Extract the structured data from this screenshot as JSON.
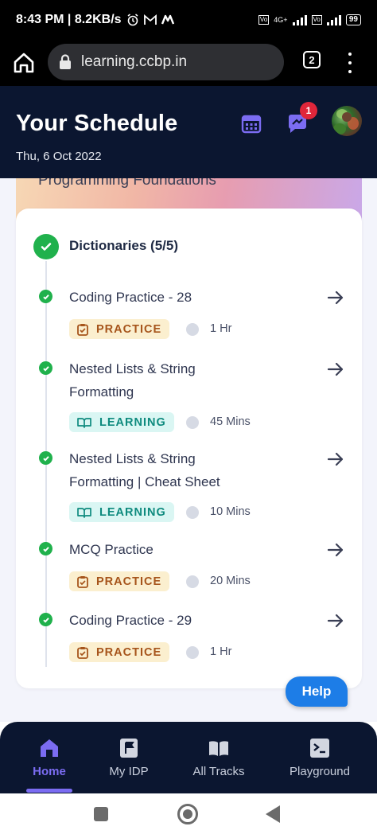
{
  "status_bar": {
    "time_speed": "8:43 PM | 8.2KB/s",
    "network": "4G+",
    "battery": "99"
  },
  "browser": {
    "url": "learning.ccbp.in",
    "tab_count": "2"
  },
  "header": {
    "title": "Your Schedule",
    "date": "Thu, 6 Oct 2022",
    "notification_count": "1"
  },
  "banner": {
    "course_title": "Programming Foundations"
  },
  "section": {
    "title": "Dictionaries (5/5)",
    "items": [
      {
        "title": "Coding Practice - 28",
        "tag": "PRACTICE",
        "duration": "1 Hr"
      },
      {
        "title": "Nested Lists & String Formatting",
        "tag": "LEARNING",
        "duration": "45 Mins"
      },
      {
        "title": "Nested Lists & String Formatting | Cheat Sheet",
        "tag": "LEARNING",
        "duration": "10 Mins"
      },
      {
        "title": "MCQ Practice",
        "tag": "PRACTICE",
        "duration": "20 Mins"
      },
      {
        "title": "Coding Practice - 29",
        "tag": "PRACTICE",
        "duration": "1 Hr"
      }
    ]
  },
  "help": {
    "label": "Help"
  },
  "bottom_nav": {
    "items": [
      {
        "label": "Home",
        "icon": "home-icon",
        "active": true
      },
      {
        "label": "My IDP",
        "icon": "flag-icon",
        "active": false
      },
      {
        "label": "All Tracks",
        "icon": "book-icon",
        "active": false
      },
      {
        "label": "Playground",
        "icon": "terminal-icon",
        "active": false
      }
    ]
  },
  "colors": {
    "header_bg": "#0b1630",
    "accent": "#7b6cf2",
    "success": "#20b14c",
    "practice_bg": "#fbefcf",
    "practice_text": "#a6541b",
    "learning_bg": "#daf6f3",
    "learning_text": "#0e8a7e",
    "help_button": "#1d7de7"
  }
}
